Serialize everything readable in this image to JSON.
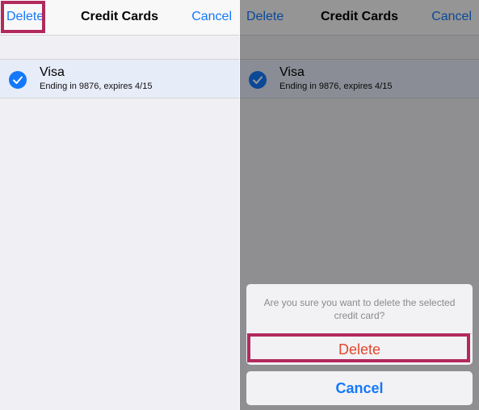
{
  "navbar": {
    "title": "Credit Cards",
    "delete_label": "Delete",
    "cancel_label": "Cancel"
  },
  "card": {
    "name": "Visa",
    "detail": "Ending in 9876, expires 4/15",
    "selected": true
  },
  "action_sheet": {
    "message": "Are you sure you want to delete the selected credit card?",
    "delete_label": "Delete",
    "cancel_label": "Cancel"
  },
  "colors": {
    "accent": "#1478fa",
    "destructive": "#e3462d",
    "highlight": "#b2295d",
    "selected_row": "#e6ecf8"
  }
}
